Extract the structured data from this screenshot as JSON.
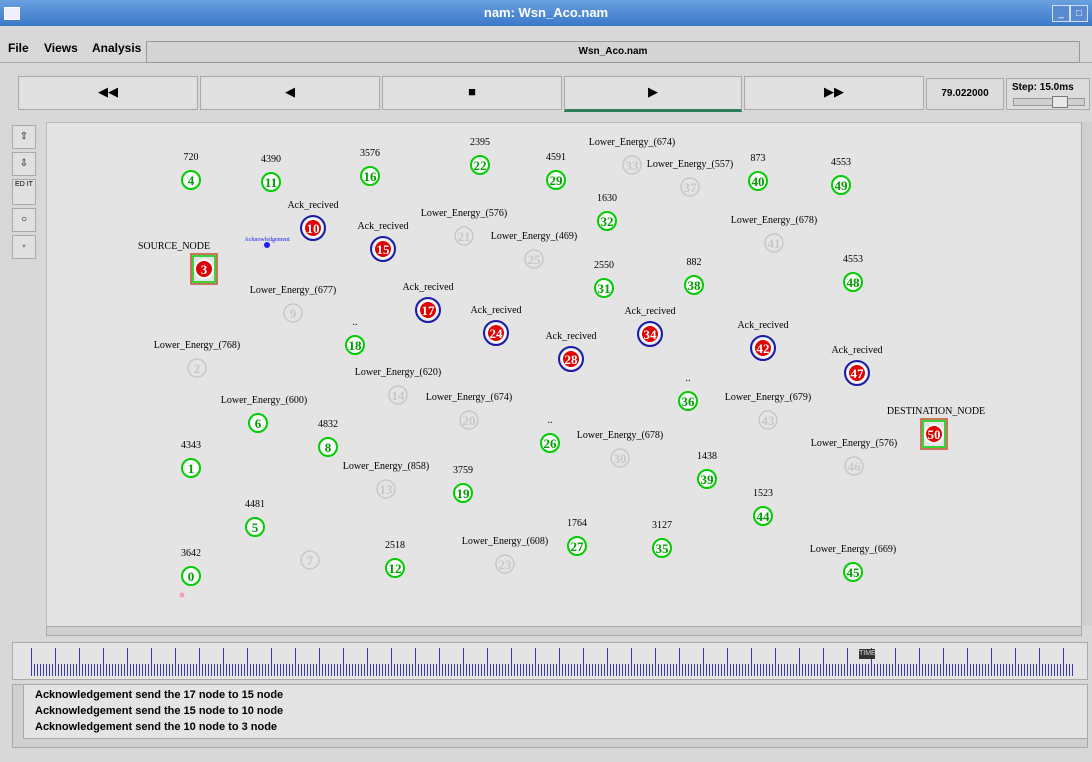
{
  "window": {
    "title": "nam: Wsn_Aco.nam",
    "min": "_",
    "max": "□",
    "close": "✕"
  },
  "menu": {
    "file": "File",
    "views": "Views",
    "analysis": "Analysis",
    "filename": "Wsn_Aco.nam"
  },
  "controls": {
    "rewind": "◀◀",
    "back": "◀",
    "stop": "■",
    "play": "▶",
    "ffwd": "▶▶",
    "time": "79.022000",
    "step": "Step: 15.0ms"
  },
  "tools": {
    "zoom_in": "⇧",
    "zoom_out": "⇩",
    "edit": "ED IT",
    "circle1": "○",
    "circle2": "◦"
  },
  "colors": {
    "active_node": "#00cc00",
    "ack_node_fill": "#e00000",
    "ack_ring": "#1a1aa8",
    "dead_node": "#c8c8c8",
    "endpoint_box": "#c05030"
  },
  "nodes": [
    {
      "id": "0",
      "label": "3642",
      "state": "active"
    },
    {
      "id": "1",
      "label": "4343",
      "state": "active"
    },
    {
      "id": "2",
      "label": "Lower_Energy_(768)",
      "state": "dead"
    },
    {
      "id": "3",
      "label": "SOURCE_NODE",
      "state": "source"
    },
    {
      "id": "4",
      "label": "720",
      "state": "active"
    },
    {
      "id": "5",
      "label": "4481",
      "state": "active"
    },
    {
      "id": "6",
      "label": "Lower_Energy_(600)",
      "state": "active"
    },
    {
      "id": "7",
      "label": "",
      "state": "dead"
    },
    {
      "id": "8",
      "label": "4832",
      "state": "active"
    },
    {
      "id": "9",
      "label": "Lower_Energy_(677)",
      "state": "dead"
    },
    {
      "id": "10",
      "label": "Ack_recived",
      "state": "ack"
    },
    {
      "id": "11",
      "label": "4390",
      "state": "active"
    },
    {
      "id": "12",
      "label": "2518",
      "state": "active"
    },
    {
      "id": "13",
      "label": "Lower_Energy_(858)",
      "state": "dead"
    },
    {
      "id": "14",
      "label": "Lower_Energy_(620)",
      "state": "dead"
    },
    {
      "id": "15",
      "label": "Ack_recived",
      "state": "ack"
    },
    {
      "id": "16",
      "label": "3576",
      "state": "active"
    },
    {
      "id": "17",
      "label": "Ack_recived",
      "state": "ack"
    },
    {
      "id": "18",
      "label": "..",
      "state": "active"
    },
    {
      "id": "19",
      "label": "3759",
      "state": "active"
    },
    {
      "id": "20",
      "label": "Lower_Energy_(674)",
      "state": "dead"
    },
    {
      "id": "21",
      "label": "Lower_Energy_(576)",
      "state": "dead"
    },
    {
      "id": "22",
      "label": "2395",
      "state": "active"
    },
    {
      "id": "23",
      "label": "Lower_Energy_(608)",
      "state": "dead"
    },
    {
      "id": "24",
      "label": "Ack_recived",
      "state": "ack"
    },
    {
      "id": "25",
      "label": "Lower_Energy_(469)",
      "state": "dead"
    },
    {
      "id": "26",
      "label": "..",
      "state": "active"
    },
    {
      "id": "27",
      "label": "1764",
      "state": "active"
    },
    {
      "id": "28",
      "label": "Ack_recived",
      "state": "ack"
    },
    {
      "id": "29",
      "label": "4591",
      "state": "active"
    },
    {
      "id": "30",
      "label": "Lower_Energy_(678)",
      "state": "dead"
    },
    {
      "id": "31",
      "label": "2550",
      "state": "active"
    },
    {
      "id": "32",
      "label": "1630",
      "state": "active"
    },
    {
      "id": "33",
      "label": "Lower_Energy_(674)",
      "state": "dead"
    },
    {
      "id": "34",
      "label": "Ack_recived",
      "state": "ack"
    },
    {
      "id": "35",
      "label": "3127",
      "state": "active"
    },
    {
      "id": "36",
      "label": "..",
      "state": "active"
    },
    {
      "id": "37",
      "label": "Lower_Energy_(557)",
      "state": "dead"
    },
    {
      "id": "38",
      "label": "882",
      "state": "active"
    },
    {
      "id": "39",
      "label": "1438",
      "state": "active"
    },
    {
      "id": "40",
      "label": "873",
      "state": "active"
    },
    {
      "id": "41",
      "label": "Lower_Energy_(678)",
      "state": "dead"
    },
    {
      "id": "42",
      "label": "Ack_recived",
      "state": "ack"
    },
    {
      "id": "43",
      "label": "Lower_Energy_(679)",
      "state": "dead"
    },
    {
      "id": "44",
      "label": "1523",
      "state": "active"
    },
    {
      "id": "45",
      "label": "Lower_Energy_(669)",
      "state": "active"
    },
    {
      "id": "46",
      "label": "Lower_Energy_(576)",
      "state": "dead"
    },
    {
      "id": "47",
      "label": "Ack_recived",
      "state": "ack"
    },
    {
      "id": "48",
      "label": "4553",
      "state": "active"
    },
    {
      "id": "49",
      "label": "4553",
      "state": "active"
    },
    {
      "id": "50",
      "label": "DESTINATION_NODE",
      "state": "destination"
    }
  ],
  "packet_label": "Acknowledgement",
  "timeline": {
    "marker": "TIME"
  },
  "log": [
    "Acknowledgement send the 17 node to 15 node",
    "Acknowledgement send the 15 node to 10 node",
    "Acknowledgement send the 10 node to 3 node"
  ]
}
